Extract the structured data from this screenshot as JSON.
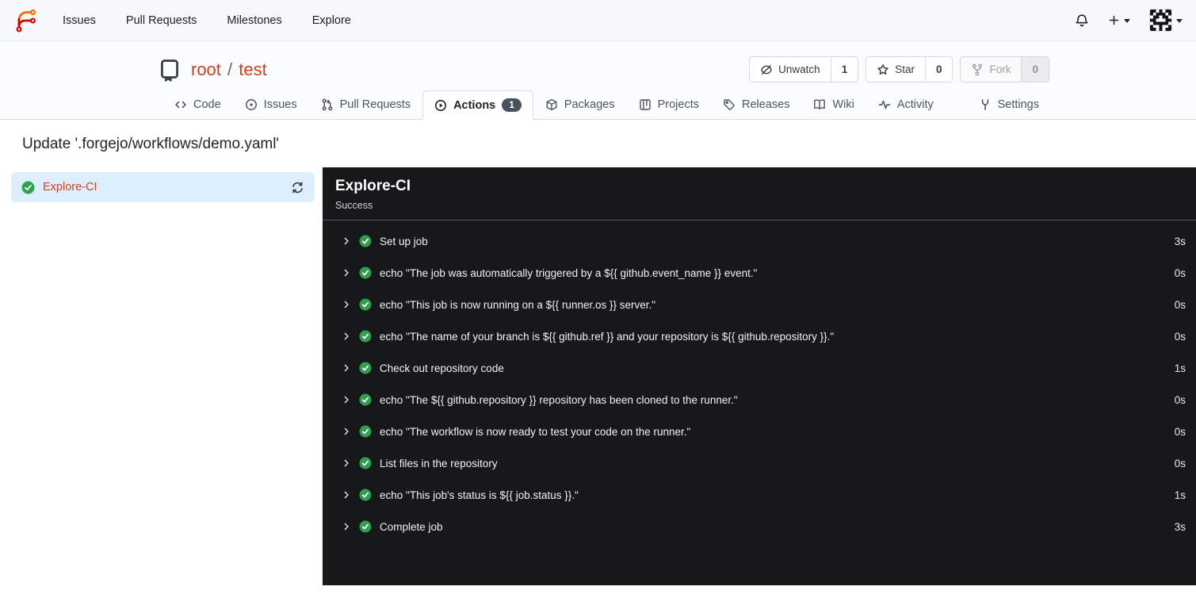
{
  "colors": {
    "accent_link": "#c8431e",
    "success_green": "#2da44e",
    "badge_bg": "#49525e",
    "selected_job_bg": "#ddeefe",
    "log_panel_bg": "#17181a"
  },
  "icons": [
    "forgejo-logo",
    "bell-icon",
    "plus-icon",
    "caret-down-icon",
    "avatar-identicon",
    "repo-book-icon",
    "eye-slash-icon",
    "star-icon",
    "fork-icon",
    "code-icon",
    "issue-icon",
    "pull-request-icon",
    "play-circle-icon",
    "package-icon",
    "projects-icon",
    "tag-icon",
    "book-icon",
    "pulse-icon",
    "tools-icon",
    "check-circle-icon",
    "sync-icon",
    "chevron-right-icon"
  ],
  "navbar": {
    "links": [
      {
        "label": "Issues"
      },
      {
        "label": "Pull Requests"
      },
      {
        "label": "Milestones"
      },
      {
        "label": "Explore"
      }
    ]
  },
  "repo": {
    "owner": "root",
    "separator": "/",
    "name": "test"
  },
  "repo_actions": {
    "unwatch": {
      "label": "Unwatch",
      "count": "1"
    },
    "star": {
      "label": "Star",
      "count": "0"
    },
    "fork": {
      "label": "Fork",
      "count": "0",
      "disabled": true
    }
  },
  "tabs": {
    "code": {
      "label": "Code"
    },
    "issues": {
      "label": "Issues"
    },
    "pulls": {
      "label": "Pull Requests"
    },
    "actions": {
      "label": "Actions",
      "badge": "1",
      "active": true
    },
    "packages": {
      "label": "Packages"
    },
    "projects": {
      "label": "Projects"
    },
    "releases": {
      "label": "Releases"
    },
    "wiki": {
      "label": "Wiki"
    },
    "activity": {
      "label": "Activity"
    },
    "settings": {
      "label": "Settings"
    }
  },
  "run": {
    "title": "Update '.forgejo/workflows/demo.yaml'",
    "jobs": [
      {
        "name": "Explore-CI",
        "status": "success"
      }
    ],
    "panel": {
      "title": "Explore-CI",
      "status": "Success"
    },
    "steps": [
      {
        "name": "Set up job",
        "duration": "3s"
      },
      {
        "name": "echo \"The job was automatically triggered by a ${{ github.event_name }} event.\"",
        "duration": "0s"
      },
      {
        "name": "echo \"This job is now running on a ${{ runner.os }} server.\"",
        "duration": "0s"
      },
      {
        "name": "echo \"The name of your branch is ${{ github.ref }} and your repository is ${{ github.repository }}.\"",
        "duration": "0s"
      },
      {
        "name": "Check out repository code",
        "duration": "1s"
      },
      {
        "name": "echo \"The ${{ github.repository }} repository has been cloned to the runner.\"",
        "duration": "0s"
      },
      {
        "name": "echo \"The workflow is now ready to test your code on the runner.\"",
        "duration": "0s"
      },
      {
        "name": "List files in the repository",
        "duration": "0s"
      },
      {
        "name": "echo \"This job's status is ${{ job.status }}.\"",
        "duration": "1s"
      },
      {
        "name": "Complete job",
        "duration": "3s"
      }
    ]
  }
}
